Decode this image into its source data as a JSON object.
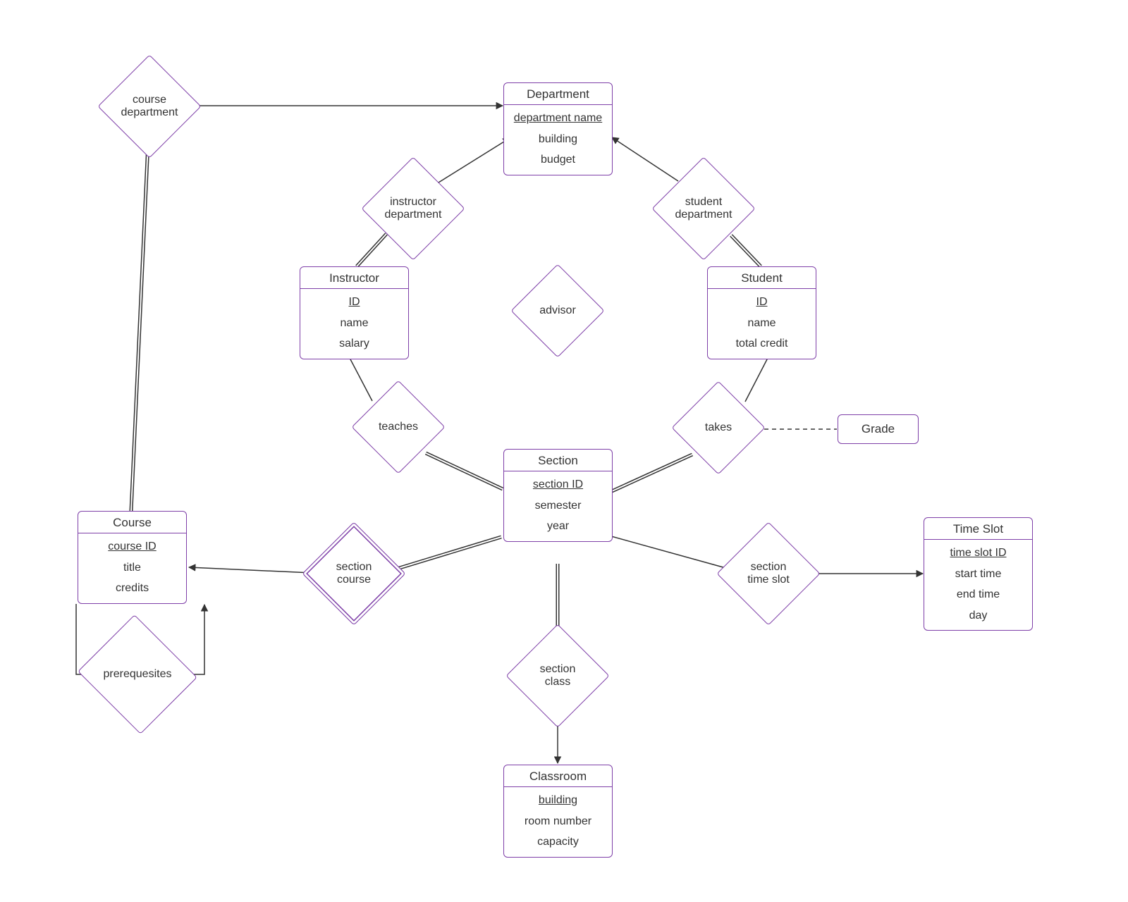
{
  "entities": {
    "department": {
      "title": "Department",
      "attrs": [
        "department name",
        "building",
        "budget"
      ],
      "keys": [
        0
      ]
    },
    "instructor": {
      "title": "Instructor",
      "attrs": [
        "ID",
        "name",
        "salary"
      ],
      "keys": [
        0
      ]
    },
    "student": {
      "title": "Student",
      "attrs": [
        "ID",
        "name",
        "total credit"
      ],
      "keys": [
        0
      ]
    },
    "section": {
      "title": "Section",
      "attrs": [
        "section ID",
        "semester",
        "year"
      ],
      "keys": [
        0
      ]
    },
    "course": {
      "title": "Course",
      "attrs": [
        "course ID",
        "title",
        "credits"
      ],
      "keys": [
        0
      ]
    },
    "classroom": {
      "title": "Classroom",
      "attrs": [
        "building",
        "room number",
        "capacity"
      ],
      "keys": [
        0
      ]
    },
    "timeslot": {
      "title": "Time Slot",
      "attrs": [
        "time slot ID",
        "start time",
        "end time",
        "day"
      ],
      "keys": [
        0
      ]
    }
  },
  "relationships": {
    "course_dept": {
      "label": "course\ndepartment"
    },
    "instr_dept": {
      "label": "instructor\ndepartment"
    },
    "student_dept": {
      "label": "student\ndepartment"
    },
    "advisor": {
      "label": "advisor"
    },
    "teaches": {
      "label": "teaches"
    },
    "takes": {
      "label": "takes"
    },
    "section_course": {
      "label": "section\ncourse"
    },
    "section_class": {
      "label": "section\nclass"
    },
    "section_ts": {
      "label": "section\ntime slot"
    },
    "prereq": {
      "label": "prerequesites"
    }
  },
  "extras": {
    "grade": {
      "label": "Grade"
    }
  }
}
